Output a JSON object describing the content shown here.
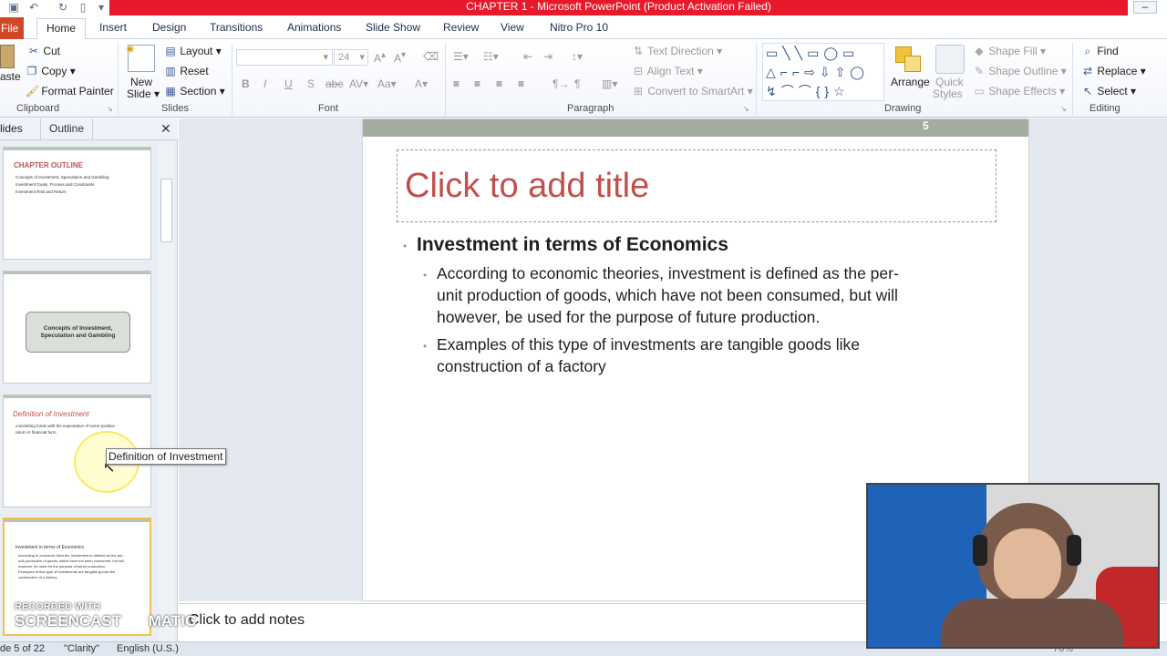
{
  "window": {
    "title": "CHAPTER 1  -  Microsoft PowerPoint (Product Activation Failed)"
  },
  "tabs": [
    "File",
    "Home",
    "Insert",
    "Design",
    "Transitions",
    "Animations",
    "Slide Show",
    "Review",
    "View",
    "Nitro Pro 10"
  ],
  "ribbon": {
    "clipboard": {
      "paste": "aste",
      "cut": "Cut",
      "copy": "Copy",
      "format_painter": "Format Painter",
      "label": "Clipboard"
    },
    "slides": {
      "new_slide_1": "New",
      "new_slide_2": "Slide",
      "layout": "Layout",
      "reset": "Reset",
      "section": "Section",
      "label": "Slides"
    },
    "font": {
      "size": "24",
      "label": "Font"
    },
    "paragraph": {
      "text_direction": "Text Direction",
      "align_text": "Align Text",
      "convert_smartart": "Convert to SmartArt",
      "label": "Paragraph"
    },
    "drawing": {
      "arrange": "Arrange",
      "quick_styles_1": "Quick",
      "quick_styles_2": "Styles",
      "shape_fill": "Shape Fill",
      "shape_outline": "Shape Outline",
      "shape_effects": "Shape Effects",
      "label": "Drawing"
    },
    "editing": {
      "find": "Find",
      "replace": "Replace",
      "select": "Select",
      "label": "Editing"
    }
  },
  "left_pane": {
    "tab_slides": "lides",
    "tab_outline": "Outline",
    "thumbs": [
      {
        "title": "CHAPTER OUTLINE",
        "lines": [
          "Concepts of Investment, Speculation and Gambling",
          "Investment Goals, Process and Constraints",
          "Investment Risk and Return"
        ]
      },
      {
        "box": "Concepts of Investment, Speculation and Gambling"
      },
      {
        "title": "Definition of Investment",
        "lines": [
          "committing funds with the expectation of some positive",
          "return in financial form"
        ]
      },
      {
        "title": "Investment in terms of Economics",
        "lines": [
          "According to economic theories, investment is defined as the per-",
          "unit production of goods, which have not been consumed, but will",
          "however, be used for the purpose of future production.",
          "Examples of this type of investments are tangible goods like",
          "construction of a factory"
        ]
      }
    ]
  },
  "tooltip": "Definition of Investment",
  "slide": {
    "number": "5",
    "title_placeholder": "Click to add title",
    "heading": "Investment  in terms  of Economics",
    "sub1_l1": "According  to economic  theories,  investment  is defined  as the  per-",
    "sub1_l2": "unit  production  of goods,  which  have  not been  consumed,  but will",
    "sub1_l3": "however,  be used  for the  purpose  of future  production.",
    "sub2_l1": "Examples  of this  type of investments  are tangible  goods like",
    "sub2_l2": "construction  of a factory"
  },
  "notes": "Click to add notes",
  "status": {
    "slide_of": "de 5 of 22",
    "theme": "\"Clarity\"",
    "language": "English (U.S.)",
    "zoom": "76%"
  },
  "watermark": {
    "line1": "RECORDED WITH",
    "line2": "SCREENCAST",
    "line3": "MATIC"
  },
  "colors": {
    "title_bar": "#e8192a",
    "file_tab": "#d24726",
    "title_placeholder": "#c0504d",
    "slide_band": "#a3ad9f",
    "selected_thumb_border": "#f3c04d"
  }
}
